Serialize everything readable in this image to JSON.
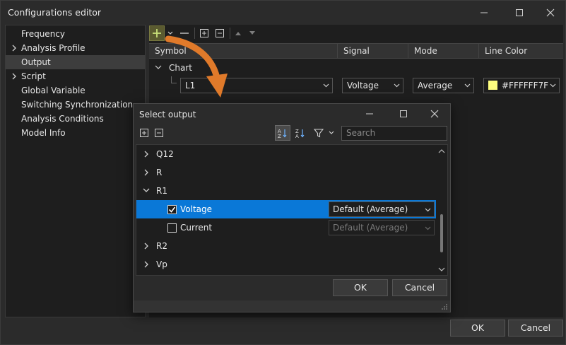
{
  "window": {
    "title": "Configurations editor"
  },
  "sidebar": {
    "items": [
      {
        "label": "Frequency",
        "expandable": false,
        "selected": false
      },
      {
        "label": "Analysis Profile",
        "expandable": true,
        "selected": false
      },
      {
        "label": "Output",
        "expandable": false,
        "selected": true
      },
      {
        "label": "Script",
        "expandable": true,
        "selected": false
      },
      {
        "label": "Global Variable",
        "expandable": false,
        "selected": false
      },
      {
        "label": "Switching Synchronization",
        "expandable": false,
        "selected": false
      },
      {
        "label": "Analysis Conditions",
        "expandable": false,
        "selected": false
      },
      {
        "label": "Model Info",
        "expandable": false,
        "selected": false
      }
    ]
  },
  "grid": {
    "columns": [
      "Symbol",
      "Signal",
      "Mode",
      "Line Color"
    ],
    "group": "Chart",
    "row": {
      "symbol": "L1",
      "signal": "Voltage",
      "mode": "Average",
      "color_label": "#FFFFFF7F",
      "color_hex": "#ffff7f"
    }
  },
  "footer": {
    "ok": "OK",
    "cancel": "Cancel"
  },
  "dialog": {
    "title": "Select output",
    "search_placeholder": "Search",
    "items": {
      "q12": "Q12",
      "r": "R",
      "r1": "R1",
      "voltage": "Voltage",
      "voltage_mode": "Default (Average)",
      "current": "Current",
      "current_mode": "Default (Average)",
      "r2": "R2",
      "vp": "Vp"
    },
    "ok": "OK",
    "cancel": "Cancel"
  },
  "colors": {
    "selection": "#0a78d7",
    "accent_arrow": "#e07a2a",
    "swatch": "#ffff7f"
  }
}
